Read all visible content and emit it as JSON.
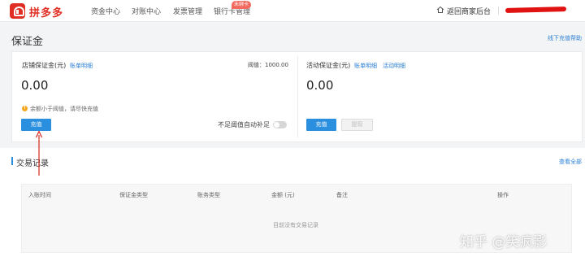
{
  "header": {
    "brand": "拼多多",
    "nav": [
      {
        "label": "资金中心"
      },
      {
        "label": "对账中心"
      },
      {
        "label": "发票管理"
      },
      {
        "label": "银行卡管理"
      }
    ],
    "badge": "未绑卡",
    "back_link": "返回商家后台",
    "accent_color": "#e02e24"
  },
  "page": {
    "title": "保证金",
    "help_link": "线下充值帮助"
  },
  "store_deposit": {
    "label": "店铺保证金(元)",
    "detail_link": "账单明细",
    "threshold": "阈值：1000.00",
    "amount": "0.00",
    "warning": "余额小于阈值，请尽快充值",
    "recharge_button": "充值",
    "auto_refill_label": "不足阈值自动补足",
    "auto_refill_on": false
  },
  "activity_deposit": {
    "label": "活动保证金(元)",
    "detail_link_1": "账单明细",
    "detail_link_2": "活动明细",
    "amount": "0.00",
    "recharge_button": "充值",
    "withdraw_button": "提现"
  },
  "transactions": {
    "title": "交易记录",
    "view_all": "查看全部",
    "columns": [
      "入账时间",
      "保证金类型",
      "账务类型",
      "金额 (元)",
      "备注",
      "操作"
    ],
    "empty_text": "目前没有交易记录"
  },
  "watermark": "知乎 @笑疯影",
  "link_color": "#2a7fd4",
  "button_color": "#2b8fe0"
}
